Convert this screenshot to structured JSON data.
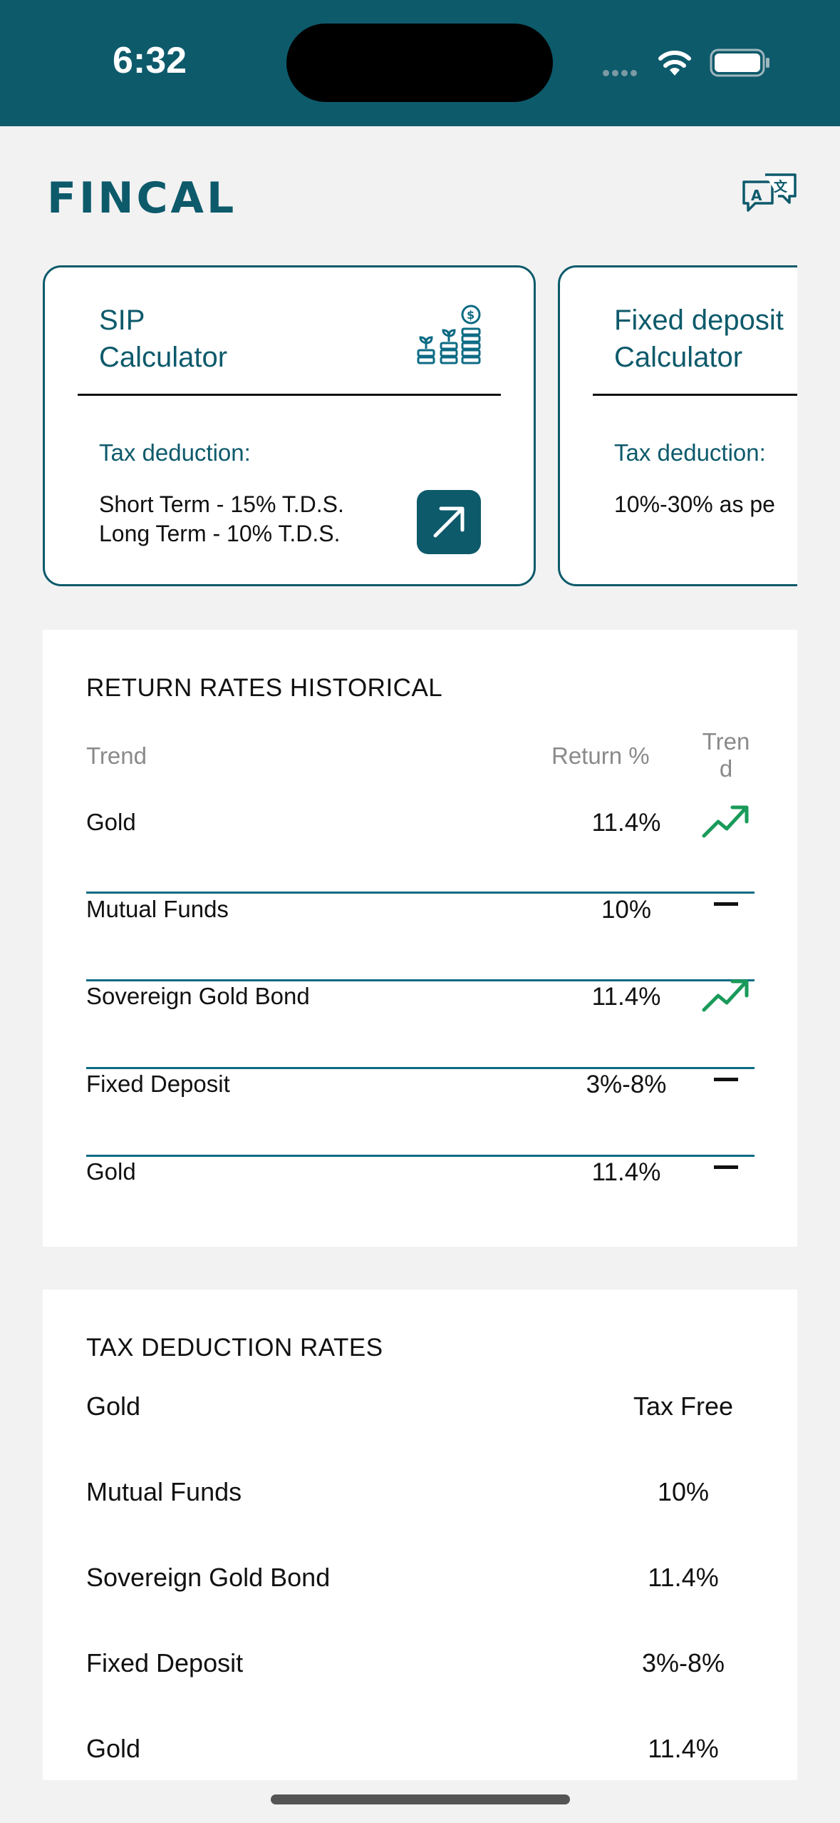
{
  "status": {
    "time": "6:32"
  },
  "app": {
    "logo": "FINCAL"
  },
  "icons": {
    "translate": "translate-icon",
    "coins": "coins-stack-icon",
    "arrow": "arrow-up-right-icon",
    "trend_up": "trend-up-icon",
    "trend_flat": "minus-icon"
  },
  "colors": {
    "brand": "#0d5a6b",
    "trend_up": "#1a9a5a",
    "background": "#f2f2f2"
  },
  "calculators": [
    {
      "title_line1": "SIP",
      "title_line2": "Calculator",
      "tax_label": "Tax deduction:",
      "line1": "Short Term - 15% T.D.S.",
      "line2": "Long Term - 10% T.D.S."
    },
    {
      "title_line1": "Fixed deposit",
      "title_line2": "Calculator",
      "tax_label": "Tax deduction:",
      "line1": "10%-30% as pe"
    }
  ],
  "returns": {
    "title": "RETURN RATES HISTORICAL",
    "headers": {
      "name": "Trend",
      "value": "Return %",
      "trend_line1": "Tren",
      "trend_line2": "d"
    },
    "rows": [
      {
        "name": "Gold",
        "value": "11.4%",
        "trend": "up"
      },
      {
        "name": "Mutual Funds",
        "value": "10%",
        "trend": "flat"
      },
      {
        "name": "Sovereign Gold Bond",
        "value": "11.4%",
        "trend": "up"
      },
      {
        "name": "Fixed Deposit",
        "value": "3%-8%",
        "trend": "flat"
      },
      {
        "name": "Gold",
        "value": "11.4%",
        "trend": "flat"
      }
    ]
  },
  "tax": {
    "title": "TAX DEDUCTION RATES",
    "rows": [
      {
        "name": "Gold",
        "value": "Tax Free"
      },
      {
        "name": "Mutual Funds",
        "value": "10%"
      },
      {
        "name": "Sovereign Gold Bond",
        "value": "11.4%"
      },
      {
        "name": "Fixed Deposit",
        "value": "3%-8%"
      },
      {
        "name": "Gold",
        "value": "11.4%"
      }
    ]
  }
}
